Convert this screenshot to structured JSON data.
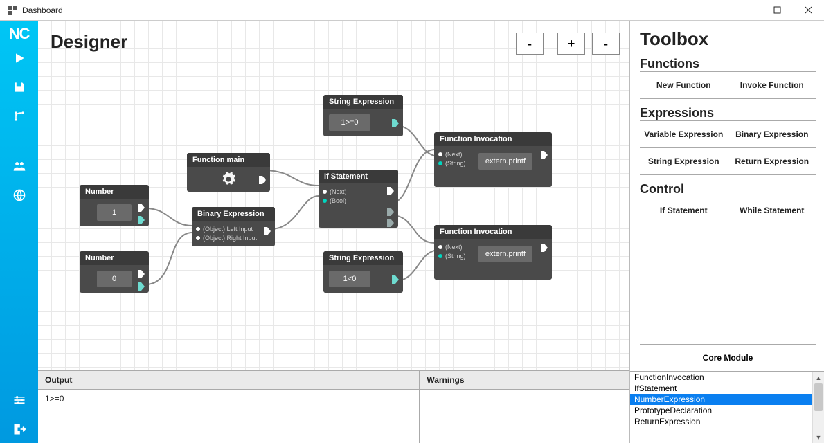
{
  "window": {
    "title": "Dashboard",
    "minimize": "–",
    "maximize": "▢",
    "close": "✕"
  },
  "sidebar": {
    "logo": "NC",
    "icons": [
      "play",
      "save",
      "branch",
      "users",
      "globe",
      "settings",
      "exit"
    ]
  },
  "designer": {
    "title": "Designer",
    "zoom": {
      "minus1": "-",
      "plus": "+",
      "minus2": "-"
    },
    "nodes": {
      "number1": {
        "header": "Number",
        "value": "1"
      },
      "number0": {
        "header": "Number",
        "value": "0"
      },
      "function_main": {
        "header": "Function main"
      },
      "binary_expr": {
        "header": "Binary Expression",
        "p1": "(Object) Left Input",
        "p2": "(Object) Right Input"
      },
      "string_expr1": {
        "header": "String Expression",
        "value": "1>=0"
      },
      "string_expr2": {
        "header": "String Expression",
        "value": "1<0"
      },
      "if_stmt": {
        "header": "If Statement",
        "p1": "(Next)",
        "p2": "(Bool)"
      },
      "func_inv1": {
        "header": "Function Invocation",
        "p1": "(Next)",
        "p2": "(String)",
        "value": "extern.printf"
      },
      "func_inv2": {
        "header": "Function Invocation",
        "p1": "(Next)",
        "p2": "(String)",
        "value": "extern.printf"
      }
    }
  },
  "output": {
    "header": "Output",
    "line1": "1>=0"
  },
  "warnings": {
    "header": "Warnings"
  },
  "toolbox": {
    "title": "Toolbox",
    "functions_section": "Functions",
    "functions": {
      "new": "New Function",
      "invoke": "Invoke Function"
    },
    "expressions_section": "Expressions",
    "expressions": {
      "variable": "Variable Expression",
      "binary": "Binary Expression",
      "string": "String Expression",
      "return": "Return Expression"
    },
    "control_section": "Control",
    "control": {
      "if": "If Statement",
      "while": "While Statement"
    },
    "core_module": "Core Module"
  },
  "typelist": {
    "items": [
      "FunctionInvocation",
      "IfStatement",
      "NumberExpression",
      "PrototypeDeclaration",
      "ReturnExpression"
    ],
    "selected_index": 2
  }
}
